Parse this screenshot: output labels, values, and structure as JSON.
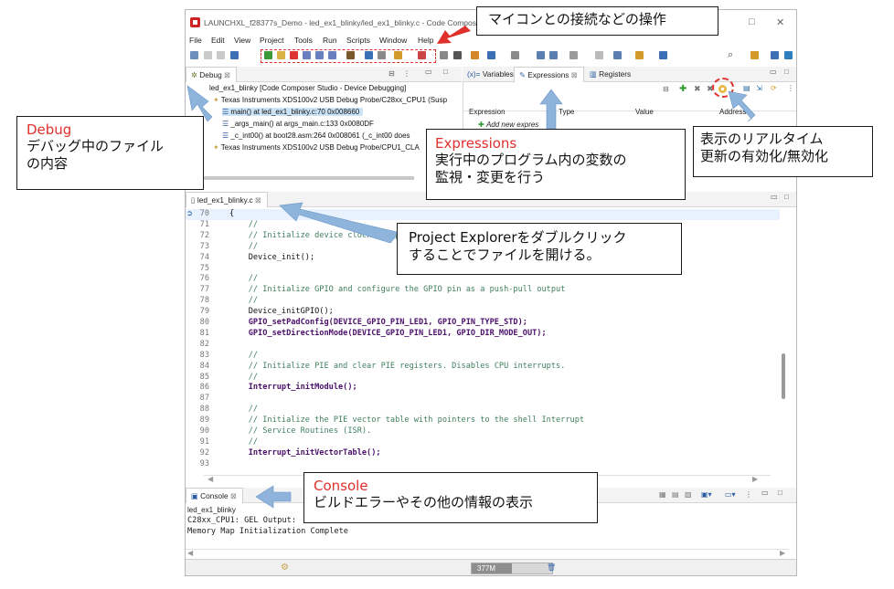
{
  "window": {
    "title": "LAUNCHXL_f28377s_Demo - led_ex1_blinky/led_ex1_blinky.c - Code Composer"
  },
  "menu": [
    "File",
    "Edit",
    "View",
    "Project",
    "Tools",
    "Run",
    "Scripts",
    "Window",
    "Help"
  ],
  "debug_view": {
    "tab_label": "Debug",
    "items": [
      "led_ex1_blinky [Code Composer Studio - Device Debugging]",
      "Texas Instruments XDS100v2 USB Debug Probe/C28xx_CPU1 (Susp",
      "main() at led_ex1_blinky.c:70 0x008660",
      "_args_main() at args_main.c:133 0x0080DF",
      "_c_int00() at boot28.asm:264 0x008061  (_c_int00 does",
      "Texas Instruments XDS100v2 USB Debug Probe/CPU1_CLA"
    ]
  },
  "expressions_view": {
    "tabs": [
      "Variables",
      "Expressions",
      "Registers"
    ],
    "columns": [
      "Expression",
      "Type",
      "Value",
      "Address"
    ],
    "add_new": "Add new expres"
  },
  "editor": {
    "tab_label": "led_ex1_blinky.c",
    "lines": [
      {
        "num": "70",
        "text": "{",
        "style": "normal",
        "current": true
      },
      {
        "num": "71",
        "text": "    //",
        "style": "comment"
      },
      {
        "num": "72",
        "text": "    // Initialize device clock and peripherals",
        "style": "comment"
      },
      {
        "num": "73",
        "text": "    //",
        "style": "comment"
      },
      {
        "num": "74",
        "text": "    Device_init();",
        "style": "normal"
      },
      {
        "num": "75",
        "text": "",
        "style": "normal"
      },
      {
        "num": "76",
        "text": "    //",
        "style": "comment"
      },
      {
        "num": "77",
        "text": "    // Initialize GPIO and configure the GPIO pin as a push-pull output",
        "style": "comment"
      },
      {
        "num": "78",
        "text": "    //",
        "style": "comment"
      },
      {
        "num": "79",
        "text": "    Device_initGPIO();",
        "style": "normal"
      },
      {
        "num": "80",
        "text": "    GPIO_setPadConfig(DEVICE_GPIO_PIN_LED1, GPIO_PIN_TYPE_STD);",
        "style": "bold"
      },
      {
        "num": "81",
        "text": "    GPIO_setDirectionMode(DEVICE_GPIO_PIN_LED1, GPIO_DIR_MODE_OUT);",
        "style": "bold"
      },
      {
        "num": "82",
        "text": "",
        "style": "normal"
      },
      {
        "num": "83",
        "text": "    //",
        "style": "comment"
      },
      {
        "num": "84",
        "text": "    // Initialize PIE and clear PIE registers. Disables CPU interrupts.",
        "style": "comment"
      },
      {
        "num": "85",
        "text": "    //",
        "style": "comment"
      },
      {
        "num": "86",
        "text": "    Interrupt_initModule();",
        "style": "bold"
      },
      {
        "num": "87",
        "text": "",
        "style": "normal"
      },
      {
        "num": "88",
        "text": "    //",
        "style": "comment"
      },
      {
        "num": "89",
        "text": "    // Initialize the PIE vector table with pointers to the shell Interrupt",
        "style": "comment"
      },
      {
        "num": "90",
        "text": "    // Service Routines (ISR).",
        "style": "comment"
      },
      {
        "num": "91",
        "text": "    //",
        "style": "comment"
      },
      {
        "num": "92",
        "text": "    Interrupt_initVectorTable();",
        "style": "bold"
      },
      {
        "num": "93",
        "text": "",
        "style": "normal"
      }
    ]
  },
  "console_view": {
    "tab_label": "Console",
    "subtitle": "led_ex1_blinky",
    "lines": [
      "C28xx_CPU1: GEL Output:",
      "Memory Map Initialization Complete"
    ]
  },
  "status": {
    "memory": "377M"
  },
  "annotations": {
    "toolbar": {
      "body": "マイコンとの接続などの操作"
    },
    "debug": {
      "heading": "Debug",
      "line1": "デバッグ中のファイル",
      "line2": "の内容"
    },
    "expressions": {
      "heading": "Expressions",
      "line1": "実行中のプログラム内の変数の",
      "line2": "監視・変更を行う"
    },
    "realtime": {
      "line1": "表示のリアルタイム",
      "line2": "更新の有効化/無効化"
    },
    "project": {
      "line1": "Project Explorerをダブルクリック",
      "line2": "することでファイルを開ける。"
    },
    "console": {
      "heading": "Console",
      "line1": "ビルドエラーやその他の情報の表示"
    }
  },
  "colors": {
    "annotation_red": "#e0302c",
    "arrow_blue": "#8fb4dc",
    "comment": "#3f7f5f",
    "keyword_purple": "#4b0f6b"
  }
}
